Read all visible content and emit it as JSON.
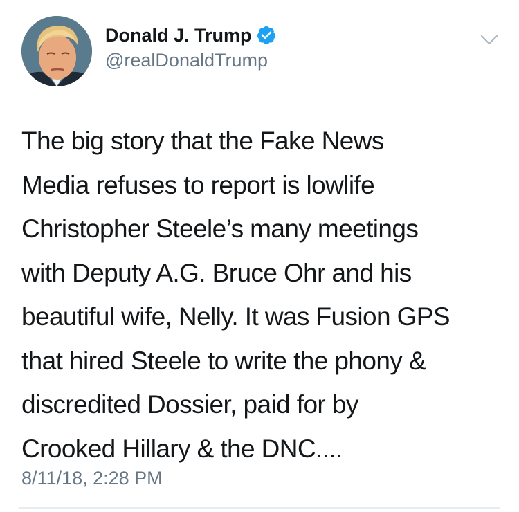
{
  "author": {
    "display_name": "Donald J. Trump",
    "handle": "@realDonaldTrump",
    "verified": true,
    "verified_icon": "verified-badge-icon",
    "avatar_icon": "profile-photo"
  },
  "menu": {
    "icon": "chevron-down-icon"
  },
  "tweet": {
    "lines": [
      "The big story that the Fake News",
      "Media refuses to report is lowlife",
      "Christopher Steele’s many meetings",
      "with Deputy A.G. Bruce Ohr and his",
      "beautiful wife, Nelly. It was Fusion GPS",
      "that hired Steele to write the phony &",
      "discredited Dossier, paid for by",
      "Crooked Hillary & the DNC...."
    ],
    "timestamp": "8/11/18, 2:28 PM"
  },
  "colors": {
    "text": "#14171a",
    "secondary_text": "#657786",
    "verified_blue": "#1da1f2",
    "divider": "#e6ecf0",
    "chevron": "#aab8c2"
  }
}
